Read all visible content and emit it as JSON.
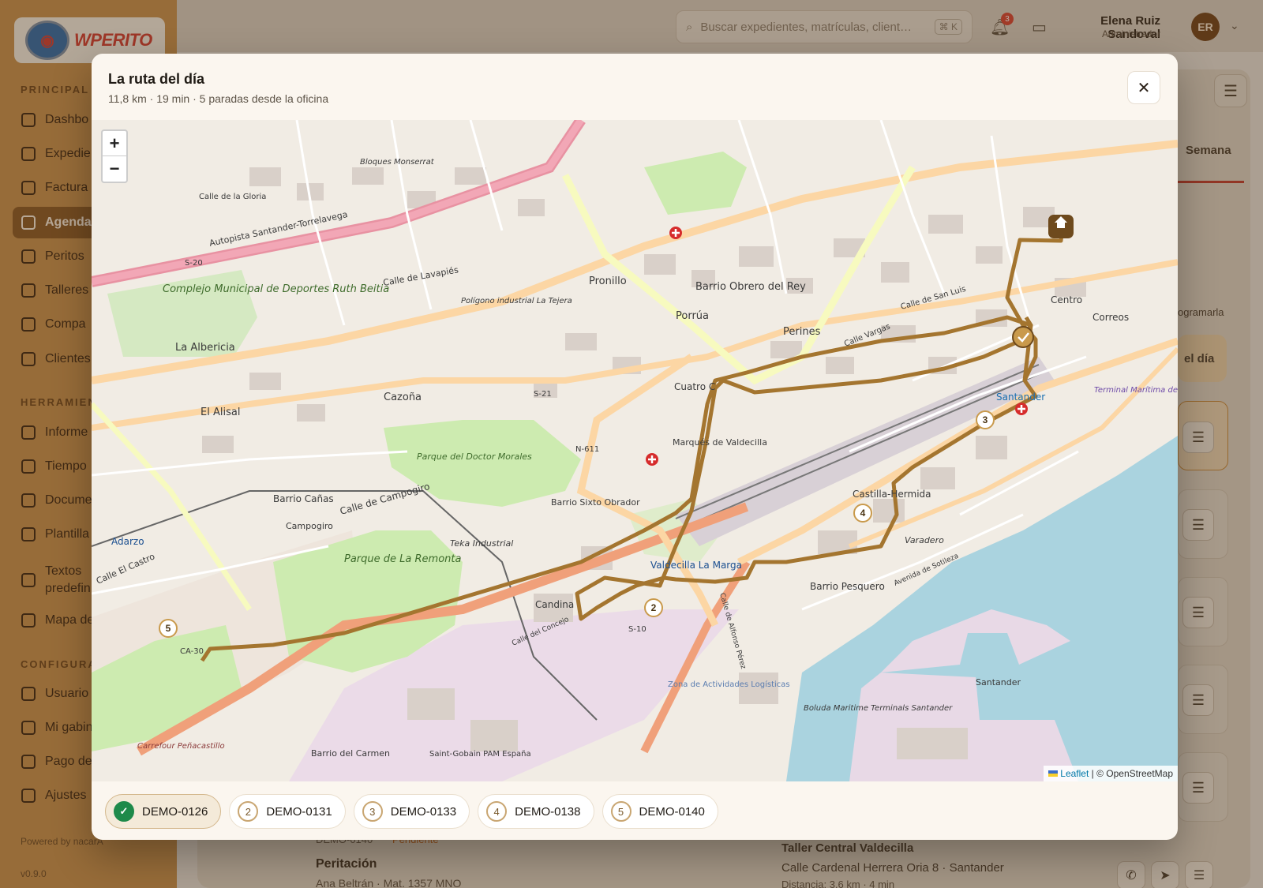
{
  "app": {
    "logo_text": "WPERITO",
    "sidebar": {
      "sections": [
        "PRINCIPAL",
        "HERRAMIEN",
        "CONFIGURA"
      ],
      "items": [
        {
          "label": "Dashbo",
          "icon": "grid-icon",
          "active": false
        },
        {
          "label": "Expedie",
          "icon": "folder-icon",
          "active": false
        },
        {
          "label": "Factura",
          "icon": "invoice-icon",
          "active": false
        },
        {
          "label": "Agenda",
          "icon": "calendar-icon",
          "active": true
        },
        {
          "label": "Peritos",
          "icon": "briefcase-icon",
          "active": false
        },
        {
          "label": "Talleres",
          "icon": "wrench-icon",
          "active": false
        },
        {
          "label": "Compa",
          "icon": "building-icon",
          "active": false
        },
        {
          "label": "Clientes",
          "icon": "users-icon",
          "active": false
        },
        {
          "label": "Informe",
          "icon": "chart-icon",
          "active": false
        },
        {
          "label": "Tiempo",
          "icon": "timer-icon",
          "active": false
        },
        {
          "label": "Docume",
          "icon": "document-icon",
          "active": false
        },
        {
          "label": "Plantilla",
          "icon": "layers-icon",
          "active": false
        },
        {
          "label": "Textos predefin",
          "icon": "quote-icon",
          "active": false
        },
        {
          "label": "Mapa de",
          "icon": "pin-icon",
          "active": false
        },
        {
          "label": "Usuario",
          "icon": "user-icon",
          "active": false
        },
        {
          "label": "Mi gabin",
          "icon": "office-icon",
          "active": false
        },
        {
          "label": "Pago de",
          "icon": "card-icon",
          "active": false
        },
        {
          "label": "Ajustes",
          "icon": "sliders-icon",
          "active": false
        }
      ],
      "powered_by": "Powered by nacarA",
      "version": "v0.9.0"
    },
    "topbar": {
      "search_placeholder": "Buscar expedientes, matrículas, client…",
      "search_shortcut": "⌘ K",
      "notification_count": "3",
      "user_name": "Elena Ruiz Sandoval",
      "user_role": "Administrador",
      "user_initials": "ER"
    },
    "background": {
      "tab_semana": "Semana",
      "reprogramar": "ogramarla",
      "dia_button": "el día",
      "row": {
        "code": "DEMO-0140",
        "status": "Pendiente",
        "title": "Peritación",
        "subtitle": "Ana Beltrán · Mat. 1357 MNO",
        "workshop": "Taller Central Valdecilla",
        "address": "Calle Cardenal Herrera Oria 8 · Santander",
        "distance": "Distancia: 3,6 km · 4 min"
      }
    }
  },
  "modal": {
    "title": "La ruta del día",
    "subtitle": "11,8 km · 19 min · 5 paradas desde la oficina",
    "zoom_in": "+",
    "zoom_out": "−",
    "attribution_leaflet": "Leaflet",
    "attribution_rest": "| © OpenStreetMap",
    "stops": [
      {
        "label": "DEMO-0126",
        "number": "✓",
        "done": true
      },
      {
        "label": "DEMO-0131",
        "number": "2",
        "done": false
      },
      {
        "label": "DEMO-0133",
        "number": "3",
        "done": false
      },
      {
        "label": "DEMO-0138",
        "number": "4",
        "done": false
      },
      {
        "label": "DEMO-0140",
        "number": "5",
        "done": false
      }
    ],
    "map_labels": {
      "autopista": "Autopista Santander-Torrelavega",
      "s20": "S-20",
      "complejo": "Complejo Municipal de Deportes Ruth Beitia",
      "albericia": "La Albericia",
      "alisal": "El Alisal",
      "cazona": "Cazoña",
      "parque_doctor": "Parque del Doctor Morales",
      "pronillo": "Pronillo",
      "barrio_obrero": "Barrio Obrero del Rey",
      "porrua": "Porrúa",
      "perines": "Perines",
      "centro": "Centro",
      "correos": "Correos",
      "cuatro_caminos": "Cuatro C",
      "marques": "Marqués de Valdecilla",
      "castilla": "Castilla-Hermida",
      "varadero": "Varadero",
      "barrio_pesquero": "Barrio Pesquero",
      "santander_station": "Santander",
      "terminal": "Terminal Marítima de Santander",
      "parque_remonta": "Parque de La Remonta",
      "campogiro": "Campogiro",
      "adarzo": "Adarzo",
      "candina": "Candina",
      "teka": "Teka Industrial",
      "valdecilla": "Valdecilla La Marga",
      "barrio_canas": "Barrio Cañas",
      "barrio_sixto": "Barrio Sixto Obrador",
      "calle_campogiro": "Calle de Campogiro",
      "calle_lavapies": "Calle de Lavapiés",
      "n611": "N-611",
      "s21": "S-21",
      "s10": "S-10",
      "ca30": "CA-30",
      "santander_port": "Santander",
      "boluda": "Boluda Maritime Terminals Santander",
      "zona_actividades": "Zona de Actividades Logísticas",
      "poligono": "Polígono industrial La Tejera",
      "bloques": "Bloques Monserrat",
      "barrio_carmen": "Barrio del Carmen",
      "carrefour": "Carrefour Peñacastillo",
      "saint_gobain": "Saint-Gobain PAM España",
      "calle_vargas": "Calle Vargas",
      "calle_san_luis": "Calle de San Luis",
      "calle_gloria": "Calle de la Gloria",
      "calle_el_castro": "Calle El Castro",
      "avenida_sotileza": "Avenida de Sotileza",
      "calle_alfonso": "Calle de Alfonso Pérez",
      "calle_concejo": "Calle del Concejo"
    }
  }
}
